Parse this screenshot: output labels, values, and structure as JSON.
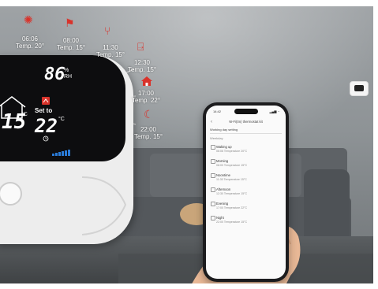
{
  "thermostat": {
    "humidity": "86",
    "humidity_unit_1": "%",
    "humidity_unit_2": "RH",
    "current_temp": "15",
    "current_unit": "°C",
    "set_label": "Set to",
    "set_temp": "22",
    "set_unit": "°C"
  },
  "schedule_callouts": [
    {
      "time": "06:06",
      "temp": "Temp. 20°",
      "icon": "wake-up-icon"
    },
    {
      "time": "08:00",
      "temp": "Temp. 15°",
      "icon": "leave-home-icon"
    },
    {
      "time": "11:30",
      "temp": "Temp. 15°",
      "icon": "lunch-icon"
    },
    {
      "time": "12:30",
      "temp": "Temp. 15°",
      "icon": "exit-door-icon"
    },
    {
      "time": "17:00",
      "temp": "Temp. 22°",
      "icon": "home-icon"
    },
    {
      "time": "22:00",
      "temp": "Temp. 15°",
      "icon": "moon-icon"
    }
  ],
  "phone": {
    "time": "14:42",
    "header": "W-Fi(tm) thermostat kit",
    "working_day_label": "Working day setting",
    "section_label": "Weekday",
    "items": [
      {
        "title": "Waking up",
        "sub": "06:06  Temperature 20°C"
      },
      {
        "title": "Morning",
        "sub": "08:00  Temperature 15°C"
      },
      {
        "title": "Noontime",
        "sub": "11:30  Temperature 15°C"
      },
      {
        "title": "Afternoon",
        "sub": "12:30  Temperature 15°C"
      },
      {
        "title": "Evening",
        "sub": "17:00  Temperature 22°C"
      },
      {
        "title": "Night",
        "sub": "22:00  Temperature 15°C"
      }
    ]
  },
  "colors": {
    "accent_red": "#d9332b",
    "display_blue": "#2a7bd8"
  }
}
